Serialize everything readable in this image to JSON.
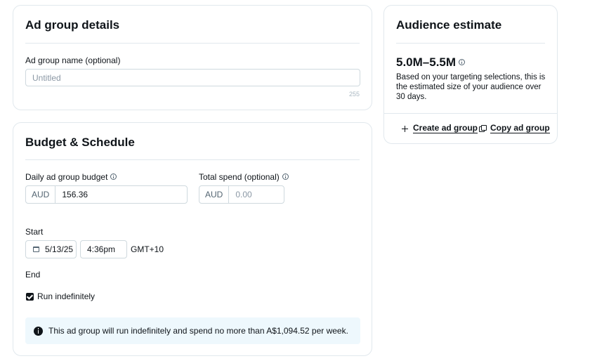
{
  "ad_group_details": {
    "title": "Ad group details",
    "name_label": "Ad group name",
    "name_optional": "(optional)",
    "name_placeholder": "Untitled",
    "name_counter": "255"
  },
  "budget_schedule": {
    "title": "Budget & Schedule",
    "daily_label": "Daily ad group budget",
    "daily_currency": "AUD",
    "daily_value": "156.36",
    "total_label": "Total spend",
    "total_optional": "(optional)",
    "total_currency": "AUD",
    "total_placeholder": "0.00",
    "start_label": "Start",
    "start_date": "5/13/25",
    "start_time": "4:36pm",
    "timezone": "GMT+10",
    "end_label": "End",
    "run_indefinitely_label": "Run indefinitely",
    "run_indefinitely_checked": true,
    "notice": "This ad group will run indefinitely and spend no more than A$1,094.52 per week."
  },
  "audience_estimate": {
    "title": "Audience estimate",
    "range": "5.0M–5.5M",
    "description": "Based on your targeting selections, this is the estimated size of your audience over 30 days.",
    "create_label": "Create ad group",
    "copy_label": "Copy ad group"
  },
  "icons": {
    "info": "info-icon",
    "calendar": "calendar-icon",
    "plus": "plus-icon",
    "copy": "copy-icon",
    "notice": "info-filled-icon",
    "checkbox": "checkbox-checked-icon"
  }
}
